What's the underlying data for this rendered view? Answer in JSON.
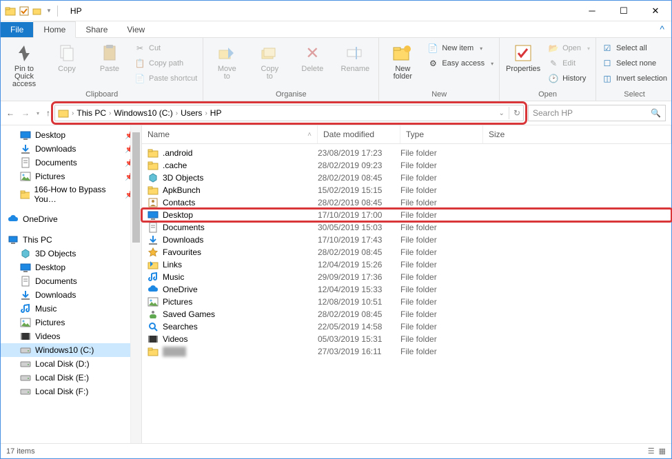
{
  "title": "HP",
  "tabs": {
    "file": "File",
    "home": "Home",
    "share": "Share",
    "view": "View"
  },
  "ribbon": {
    "clipboard": {
      "label": "Clipboard",
      "pin": "Pin to Quick\naccess",
      "copy": "Copy",
      "paste": "Paste",
      "cut": "Cut",
      "copypath": "Copy path",
      "pasteshort": "Paste shortcut"
    },
    "organise": {
      "label": "Organise",
      "moveto": "Move\nto",
      "copyto": "Copy\nto",
      "delete": "Delete",
      "rename": "Rename"
    },
    "new": {
      "label": "New",
      "newfolder": "New\nfolder",
      "newitem": "New item",
      "easyaccess": "Easy access"
    },
    "open": {
      "label": "Open",
      "properties": "Properties",
      "open": "Open",
      "edit": "Edit",
      "history": "History"
    },
    "select": {
      "label": "Select",
      "all": "Select all",
      "none": "Select none",
      "invert": "Invert selection"
    }
  },
  "breadcrumb": [
    "This PC",
    "Windows10 (C:)",
    "Users",
    "HP"
  ],
  "search_placeholder": "Search HP",
  "columns": {
    "name": "Name",
    "date": "Date modified",
    "type": "Type",
    "size": "Size"
  },
  "tree": {
    "quick": [
      {
        "label": "Desktop",
        "icon": "desktop",
        "pin": true
      },
      {
        "label": "Downloads",
        "icon": "down",
        "pin": true
      },
      {
        "label": "Documents",
        "icon": "doc",
        "pin": true
      },
      {
        "label": "Pictures",
        "icon": "pic",
        "pin": true
      },
      {
        "label": "166-How to Bypass You…",
        "icon": "folder",
        "pin": true
      }
    ],
    "onedrive": "OneDrive",
    "thispc": "This PC",
    "pc_items": [
      {
        "label": "3D Objects",
        "icon": "3d"
      },
      {
        "label": "Desktop",
        "icon": "desktop"
      },
      {
        "label": "Documents",
        "icon": "doc"
      },
      {
        "label": "Downloads",
        "icon": "down"
      },
      {
        "label": "Music",
        "icon": "music"
      },
      {
        "label": "Pictures",
        "icon": "pic"
      },
      {
        "label": "Videos",
        "icon": "video"
      },
      {
        "label": "Windows10 (C:)",
        "icon": "drive",
        "selected": true
      },
      {
        "label": "Local Disk (D:)",
        "icon": "drive"
      },
      {
        "label": "Local Disk (E:)",
        "icon": "drive"
      },
      {
        "label": "Local Disk (F:)",
        "icon": "drive"
      }
    ]
  },
  "rows": [
    {
      "icon": "folder",
      "name": ".android",
      "date": "23/08/2019 17:23",
      "type": "File folder"
    },
    {
      "icon": "folder",
      "name": ".cache",
      "date": "28/02/2019 09:23",
      "type": "File folder"
    },
    {
      "icon": "3d",
      "name": "3D Objects",
      "date": "28/02/2019 08:45",
      "type": "File folder"
    },
    {
      "icon": "folder",
      "name": "ApkBunch",
      "date": "15/02/2019 15:15",
      "type": "File folder"
    },
    {
      "icon": "contacts",
      "name": "Contacts",
      "date": "28/02/2019 08:45",
      "type": "File folder"
    },
    {
      "icon": "desktop",
      "name": "Desktop",
      "date": "17/10/2019 17:00",
      "type": "File folder",
      "highlight": true
    },
    {
      "icon": "doc",
      "name": "Documents",
      "date": "30/05/2019 15:03",
      "type": "File folder"
    },
    {
      "icon": "down",
      "name": "Downloads",
      "date": "17/10/2019 17:43",
      "type": "File folder"
    },
    {
      "icon": "fav",
      "name": "Favourites",
      "date": "28/02/2019 08:45",
      "type": "File folder"
    },
    {
      "icon": "links",
      "name": "Links",
      "date": "12/04/2019 15:26",
      "type": "File folder"
    },
    {
      "icon": "music",
      "name": "Music",
      "date": "29/09/2019 17:36",
      "type": "File folder"
    },
    {
      "icon": "onedrive",
      "name": "OneDrive",
      "date": "12/04/2019 15:33",
      "type": "File folder"
    },
    {
      "icon": "pic",
      "name": "Pictures",
      "date": "12/08/2019 10:51",
      "type": "File folder"
    },
    {
      "icon": "saved",
      "name": "Saved Games",
      "date": "28/02/2019 08:45",
      "type": "File folder"
    },
    {
      "icon": "search",
      "name": "Searches",
      "date": "22/05/2019 14:58",
      "type": "File folder"
    },
    {
      "icon": "video",
      "name": "Videos",
      "date": "05/03/2019 15:31",
      "type": "File folder"
    },
    {
      "icon": "folder",
      "name": "",
      "date": "27/03/2019 16:11",
      "type": "File folder",
      "blur": true
    }
  ],
  "status": "17 items"
}
